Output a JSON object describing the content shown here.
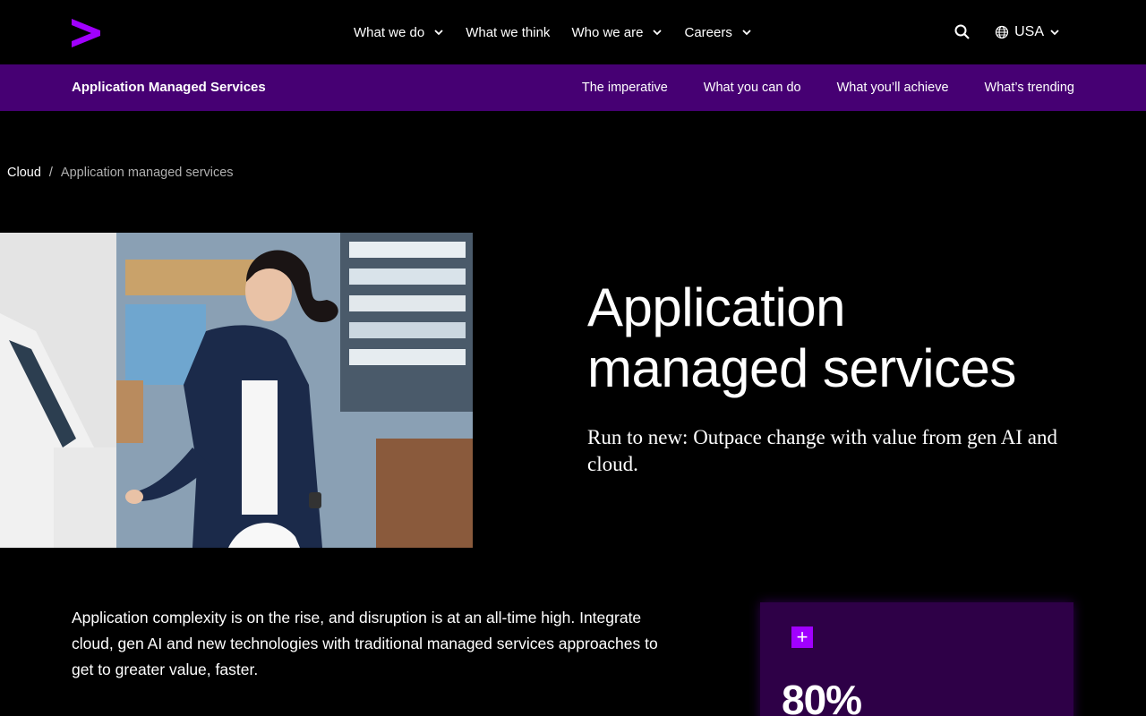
{
  "topnav": {
    "logo_alt": "",
    "items": [
      {
        "label": "What we do",
        "has_dropdown": true
      },
      {
        "label": "What we think",
        "has_dropdown": false
      },
      {
        "label": "Who we are",
        "has_dropdown": true
      },
      {
        "label": "Careers",
        "has_dropdown": true
      }
    ],
    "search_icon": "search-icon",
    "locale": "USA"
  },
  "subnav": {
    "title": "Application Managed Services",
    "links": [
      "The imperative",
      "What you can do",
      "What you’ll achieve",
      "What’s trending"
    ]
  },
  "breadcrumb": {
    "parent": "Cloud",
    "separator": "/",
    "current": "Application managed services"
  },
  "hero": {
    "title_line1": "Application",
    "title_line2": "managed services",
    "subtitle": "Run to new: Outpace change with value from gen AI and cloud."
  },
  "intro": {
    "text": "Application complexity is on the rise, and disruption is at an all-time high. Integrate cloud, gen AI and new technologies with traditional managed services approaches to get to greater value, faster."
  },
  "stat_card": {
    "expand_label": "+",
    "value": "80%"
  },
  "colors": {
    "background": "#000000",
    "subnav_bg": "#460073",
    "accent": "#a100ff",
    "card_bg": "#2e0047"
  }
}
